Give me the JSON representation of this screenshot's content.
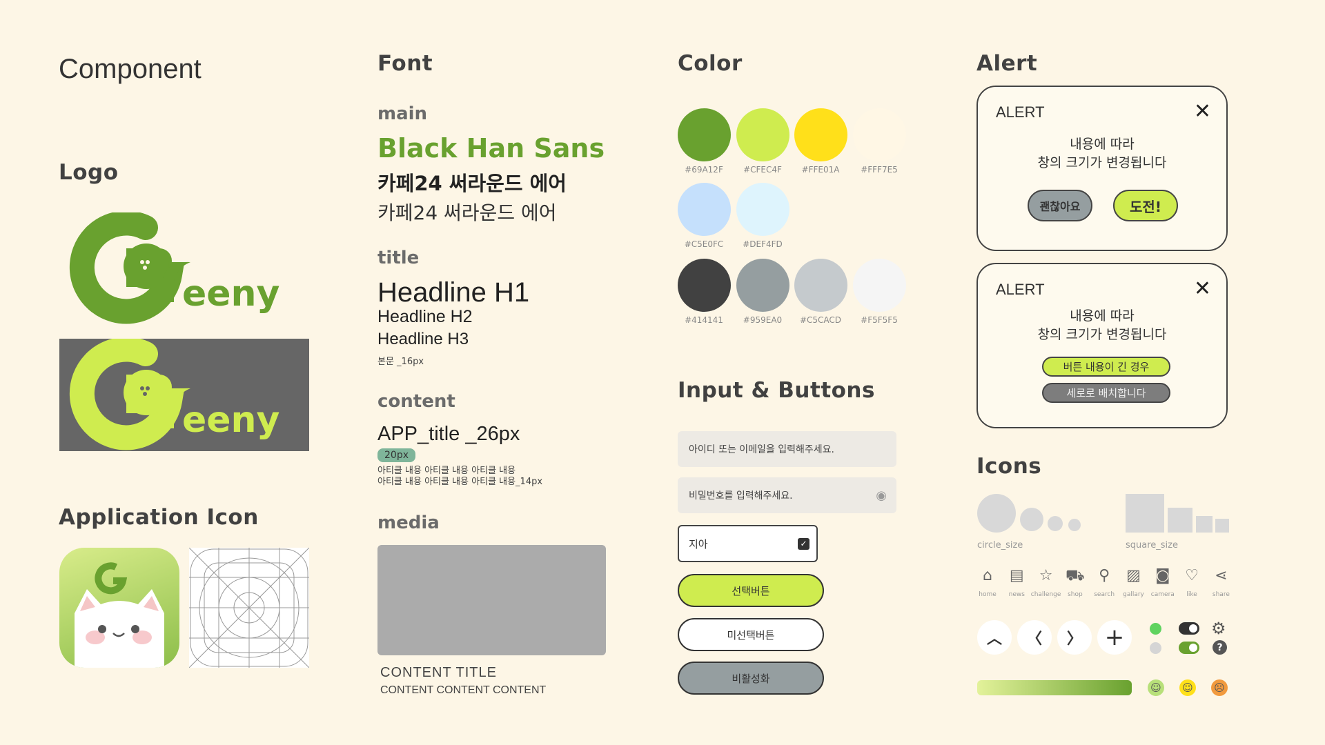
{
  "component": {
    "title": "Component"
  },
  "logo": {
    "section_title": "Logo",
    "wordmark_letter": "G",
    "wordmark_rest": "eeny"
  },
  "app_icon": {
    "section_title": "Application Icon"
  },
  "font": {
    "section_title": "Font",
    "main": {
      "label": "main",
      "sample_en": "Black Han Sans",
      "sample_kr_bold": "카페24 써라운드 에어",
      "sample_kr": "카페24 써라운드 에어"
    },
    "title": {
      "label": "title",
      "h1": "Headline H1",
      "h2": "Headline H2",
      "h3": "Headline H3",
      "body": "본문 _16px"
    },
    "content": {
      "label": "content",
      "app_title": "APP_title _26px",
      "pill": "20px",
      "line1": "아티클 내용 아티클 내용 아티클 내용",
      "line2": "아티클 내용 아티클 내용 아티클 내용_14px"
    },
    "media": {
      "label": "media",
      "content_title": "CONTENT TITLE",
      "content_text": "CONTENT CONTENT CONTENT"
    }
  },
  "color": {
    "section_title": "Color",
    "swatches": [
      {
        "hex": "#69A12F",
        "label": "#69A12F"
      },
      {
        "hex": "#CFEC4F",
        "label": "#CFEC4F"
      },
      {
        "hex": "#FFE01A",
        "label": "#FFE01A"
      },
      {
        "hex": "#FFF7E5",
        "label": "#FFF7E5"
      },
      {
        "hex": "#C5E0FC",
        "label": "#C5E0FC"
      },
      {
        "hex": "#DEF4FD",
        "label": "#DEF4FD"
      },
      {
        "hex": "#414141",
        "label": "#414141"
      },
      {
        "hex": "#959EA0",
        "label": "#959EA0"
      },
      {
        "hex": "#C5CACD",
        "label": "#C5CACD"
      },
      {
        "hex": "#F5F5F5",
        "label": "#F5F5F5"
      }
    ]
  },
  "inputs": {
    "section_title": "Input & Buttons",
    "id_placeholder": "아이디 또는 이메일을 입력해주세요.",
    "pw_placeholder": "비밀번호를 입력해주세요.",
    "check_label": "지아",
    "selected_btn": "선택버튼",
    "unselected_btn": "미선택버튼",
    "disabled_btn": "비활성화"
  },
  "alert": {
    "section_title": "Alert",
    "a1": {
      "title": "ALERT",
      "line1": "내용에 따라",
      "line2": "창의 크기가 변경됩니다",
      "btn_no": "괜찮아요",
      "btn_yes": "도전!"
    },
    "a2": {
      "title": "ALERT",
      "line1": "내용에 따라",
      "line2": "창의 크기가 변경됩니다",
      "btn1": "버튼 내용이 긴 경우",
      "btn2": "세로로 배치합니다"
    }
  },
  "icons": {
    "section_title": "Icons",
    "circle_label": "circle_size",
    "square_label": "square_size",
    "nav": [
      {
        "name": "home",
        "label": "home",
        "glyph": "⌂"
      },
      {
        "name": "news",
        "label": "news",
        "glyph": "▤"
      },
      {
        "name": "challenge",
        "label": "challenge",
        "glyph": "☆"
      },
      {
        "name": "shop",
        "label": "shop",
        "glyph": "⛟"
      },
      {
        "name": "search",
        "label": "search",
        "glyph": "⚲"
      },
      {
        "name": "gallery",
        "label": "gallary",
        "glyph": "▨"
      },
      {
        "name": "camera",
        "label": "camera",
        "glyph": "◙"
      },
      {
        "name": "like",
        "label": "like",
        "glyph": "♡"
      },
      {
        "name": "share",
        "label": "share",
        "glyph": "⋖"
      }
    ],
    "arrows": {
      "up": "︿",
      "left": "〈",
      "right": "〉",
      "plus": "+"
    },
    "gradient": {
      "from": "#E3F29A",
      "to": "#69A12F"
    },
    "faces": [
      {
        "color": "#B8E07A",
        "glyph": "☺"
      },
      {
        "color": "#FFE01A",
        "glyph": "☺"
      },
      {
        "color": "#F19A3E",
        "glyph": "☹"
      }
    ]
  }
}
